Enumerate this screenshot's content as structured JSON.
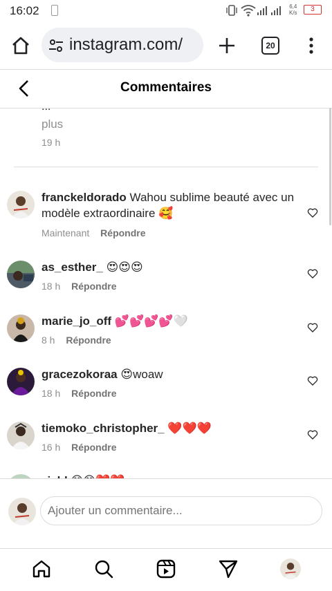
{
  "status_bar": {
    "time": "16:02",
    "net_speed_value": "6,4",
    "net_speed_unit": "K/s",
    "battery": "3"
  },
  "browser": {
    "url": "instagram.com/",
    "tab_count": "20"
  },
  "header": {
    "title": "Commentaires"
  },
  "previous_comment": {
    "ellipsis": "...",
    "more": "plus",
    "time": "19 h"
  },
  "comments": [
    {
      "username": "franckeldorado",
      "text": "Wahou sublime beauté avec un modèle extraordinaire 🥰",
      "time": "Maintenant",
      "reply": "Répondre"
    },
    {
      "username": "as_esther_",
      "text": "😍😍😍",
      "time": "18 h",
      "reply": "Répondre"
    },
    {
      "username": "marie_jo_off",
      "text": "💕💕💕💕🤍",
      "time": "8 h",
      "reply": "Répondre"
    },
    {
      "username": "gracezokoraa",
      "text": "😍woaw",
      "time": "18 h",
      "reply": "Répondre"
    },
    {
      "username": "tiemoko_christopher_",
      "text": "❤️❤️❤️",
      "time": "16 h",
      "reply": "Répondre"
    },
    {
      "username": "ziehl",
      "text": "😊😊❤️❤️"
    }
  ],
  "add_comment": {
    "placeholder": "Ajouter un commentaire..."
  },
  "colors": {
    "accent_like": "#262626",
    "muted_text": "#8e8e8e",
    "battery_low": "#d32f2f"
  }
}
